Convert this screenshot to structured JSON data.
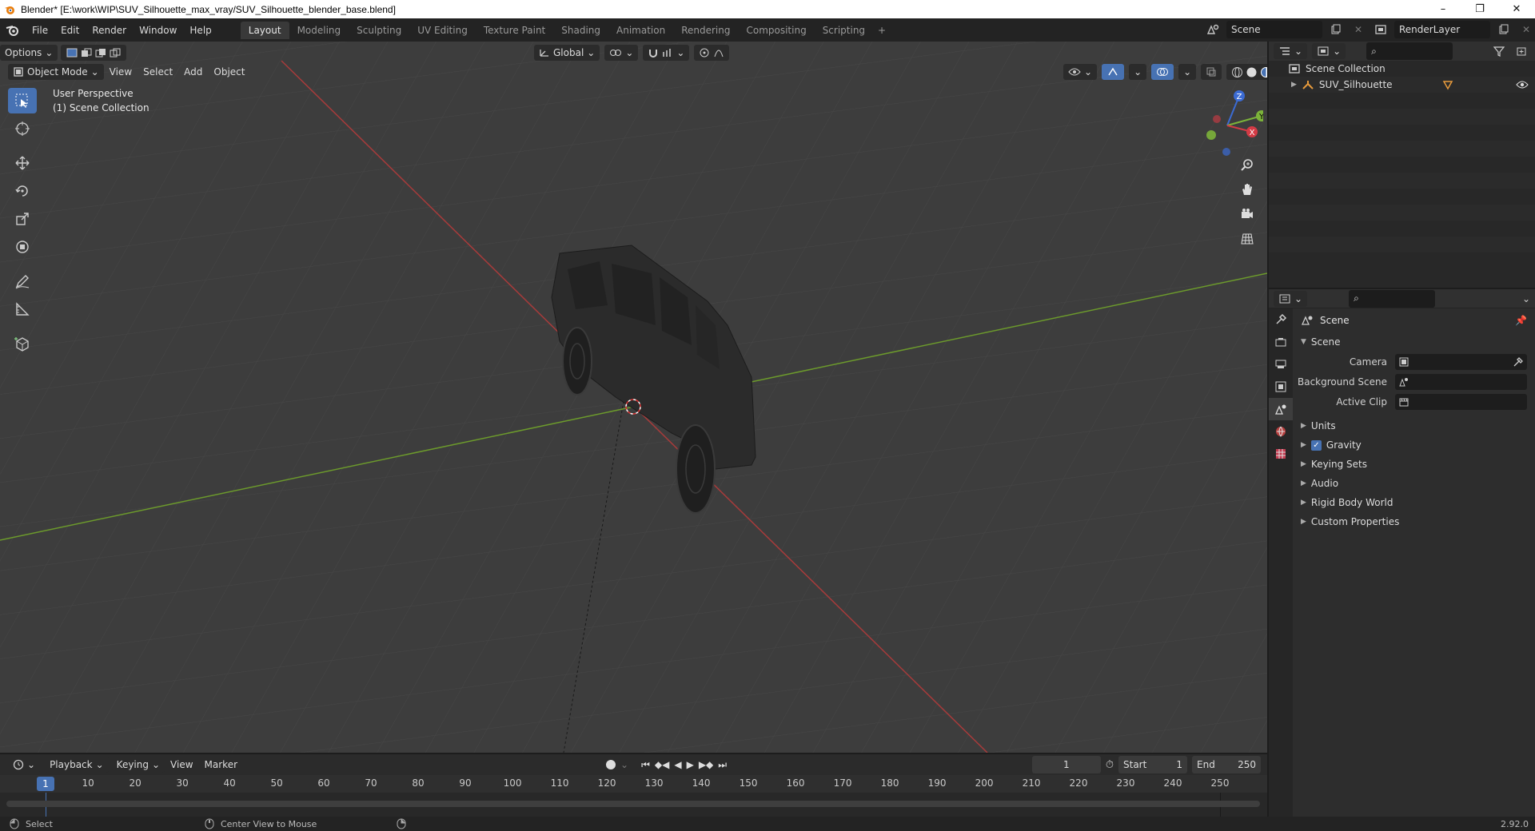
{
  "window": {
    "title": "Blender* [E:\\work\\WIP\\SUV_Silhouette_max_vray/SUV_Silhouette_blender_base.blend]",
    "minimize": "–",
    "maximize": "❐",
    "close": "✕"
  },
  "menu": [
    "File",
    "Edit",
    "Render",
    "Window",
    "Help"
  ],
  "workspaces": [
    "Layout",
    "Modeling",
    "Sculpting",
    "UV Editing",
    "Texture Paint",
    "Shading",
    "Animation",
    "Rendering",
    "Compositing",
    "Scripting"
  ],
  "workspace_add": "+",
  "scene_name": "Scene",
  "render_layer": "RenderLayer",
  "viewport": {
    "mode": "Object Mode",
    "menus": [
      "View",
      "Select",
      "Add",
      "Object"
    ],
    "transform_orientation": "Global",
    "options_label": "Options",
    "info_line1": "User Perspective",
    "info_line2": "(1) Scene Collection",
    "gizmo": {
      "x": "X",
      "y": "Y",
      "z": "Z"
    }
  },
  "outliner": {
    "root": "Scene Collection",
    "items": [
      "SUV_Silhouette"
    ]
  },
  "properties": {
    "context_title": "Scene",
    "panel_scene": "Scene",
    "rows": [
      {
        "label": "Camera",
        "value": ""
      },
      {
        "label": "Background Scene",
        "value": ""
      },
      {
        "label": "Active Clip",
        "value": ""
      }
    ],
    "panels": [
      "Units",
      "Gravity",
      "Keying Sets",
      "Audio",
      "Rigid Body World",
      "Custom Properties"
    ],
    "gravity_checked": true
  },
  "timeline": {
    "menus": [
      "Playback",
      "Keying",
      "View",
      "Marker"
    ],
    "current_frame": "1",
    "start_label": "Start",
    "start_value": "1",
    "end_label": "End",
    "end_value": "250",
    "ticks": [
      "1",
      "10",
      "20",
      "30",
      "40",
      "50",
      "60",
      "70",
      "80",
      "90",
      "100",
      "110",
      "120",
      "130",
      "140",
      "150",
      "160",
      "170",
      "180",
      "190",
      "200",
      "210",
      "220",
      "230",
      "240",
      "250"
    ]
  },
  "statusbar": {
    "select": "Select",
    "center_view": "Center View to Mouse",
    "version": "2.92.0"
  }
}
